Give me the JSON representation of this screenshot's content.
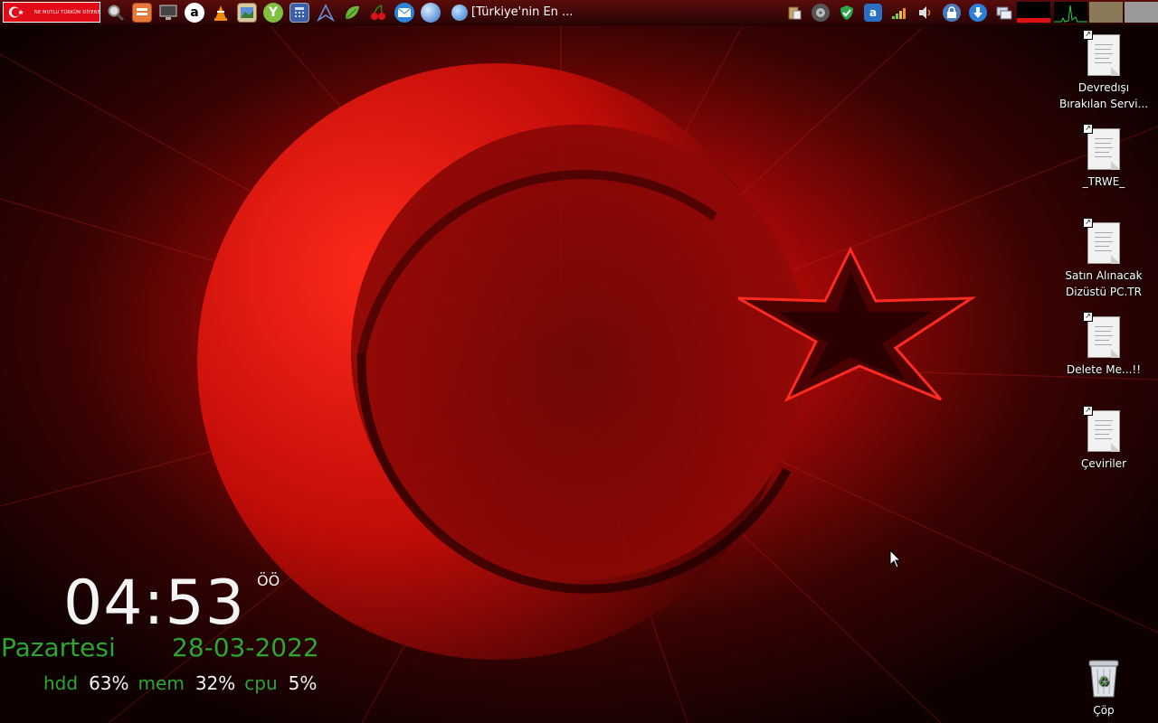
{
  "panel": {
    "menu_button": {
      "slogan": "NE MUTLU TÜRKÜM DİYENE"
    },
    "launchers": [
      {
        "icon": "search-icon"
      },
      {
        "icon": "archive-icon"
      },
      {
        "icon": "monitor-icon"
      },
      {
        "icon": "amazon-icon"
      },
      {
        "icon": "vlc-icon"
      },
      {
        "icon": "image-viewer-icon"
      },
      {
        "icon": "y-app-icon"
      },
      {
        "icon": "calculator-icon"
      },
      {
        "icon": "arch-icon"
      },
      {
        "icon": "leaf-icon"
      },
      {
        "icon": "cherry-icon"
      },
      {
        "icon": "mail-icon"
      },
      {
        "icon": "globe-icon"
      }
    ],
    "taskbar_window": {
      "title": "[Türkiye'nin En ..."
    },
    "tray": [
      {
        "icon": "clipboard-icon"
      },
      {
        "icon": "disk-utility-icon"
      },
      {
        "icon": "shield-icon"
      },
      {
        "icon": "amazon-icon"
      },
      {
        "icon": "wifi-icon"
      },
      {
        "icon": "volume-icon"
      },
      {
        "icon": "lock-icon"
      },
      {
        "icon": "download-icon"
      },
      {
        "icon": "windows-icon"
      }
    ]
  },
  "desktop_icons": [
    {
      "label": "Devredışı Bırakılan Servi..."
    },
    {
      "label": "_TRWE_"
    },
    {
      "label": "Satın Alınacak Dizüstü PC.TR"
    },
    {
      "label": "Delete Me...!!"
    },
    {
      "label": "Çeviriler"
    },
    {
      "label": "Çöp"
    }
  ],
  "widget": {
    "time": "04:53",
    "ampm": "ÖÖ",
    "day": "Pazartesi",
    "date": "28-03-2022",
    "stats": [
      {
        "label": "hdd",
        "value": "63%"
      },
      {
        "label": "mem",
        "value": "32%"
      },
      {
        "label": "cpu",
        "value": "5%"
      }
    ]
  },
  "colors": {
    "accent_green": "#2ea52e",
    "flag_red": "#e30a17",
    "panel_red": "#5a0c0c"
  }
}
